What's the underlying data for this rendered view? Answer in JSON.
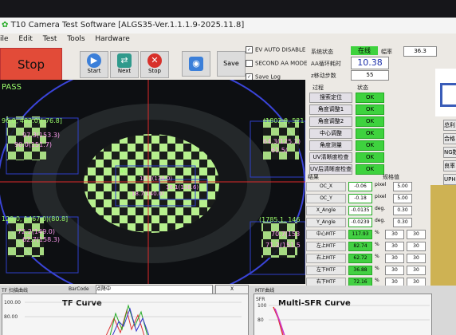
{
  "window": {
    "title": "T10 Camera Test Software [ALGS35-Ver.1.1.1.9-2025.11.8]"
  },
  "menu": [
    "ile",
    "Edit",
    "Test",
    "Tools",
    "Hardware"
  ],
  "toolbar": {
    "stop_big": "Stop",
    "start": "Start",
    "next": "Next",
    "stop": "Stop",
    "save": "Save"
  },
  "checks": [
    {
      "label": "EV AUTO DISABLE",
      "checked": true
    },
    {
      "label": "SECOND AA MODE",
      "checked": false
    },
    {
      "label": "Save Log",
      "checked": true
    }
  ],
  "status": {
    "system_label": "系统状态",
    "system_value": "在线",
    "cycle_label": "幅率",
    "cycle_value": "36.3",
    "aa_label": "AA循环耗时",
    "aa_value": "10.38",
    "z_label": "z移动步数",
    "z_value": "55"
  },
  "camera": {
    "pass_text": "PASS",
    "center_id": "#0",
    "center_coord": "18.7(140.0)",
    "center_val_a": "16.3(138.0)",
    "center_val_b": "16.1(138.6)",
    "tl_coord": "96.0, 482.0)(-76.8]",
    "tl_v1": "97.3(153.3)",
    "tl_v2": "90.0(151.7)",
    "tr_coord": "(1802.0, 521",
    "tr_v1": "64.3(125.2)",
    "tr_v2": "61.5(",
    "bl_coord": "129.0, 1467.0)(80.8]",
    "bl_v1": "72.2(149.0)",
    "bl_v2": "62.7(158.3)",
    "br_coord": "(1785.1, 146",
    "br_v1": "70.7(153",
    "br_v2": "71.2(151.5"
  },
  "process": {
    "header_process": "过程",
    "header_state": "状态",
    "steps": [
      {
        "name": "搜索定位",
        "state": "OK"
      },
      {
        "name": "角度调整1",
        "state": "OK"
      },
      {
        "name": "角度调整2",
        "state": "OK"
      },
      {
        "name": "中心调整",
        "state": "OK"
      },
      {
        "name": "角度测量",
        "state": "OK"
      },
      {
        "name": "UV清晰度检查",
        "state": "OK"
      },
      {
        "name": "UV后清晰度检查",
        "state": "OK"
      }
    ]
  },
  "results": {
    "header_result": "结果",
    "header_spec": "规格值",
    "rows": [
      {
        "name": "OC_X",
        "value": "-0.06",
        "unit": "pixel",
        "spec": "5.00"
      },
      {
        "name": "OC_Y",
        "value": "-0.18",
        "unit": "pixel",
        "spec": "5.00"
      },
      {
        "name": "X_Angle",
        "value": "-0.0135",
        "unit": "deg.",
        "spec": "0.30"
      },
      {
        "name": "Y_Angle",
        "value": "-0.0239",
        "unit": "deg.",
        "spec": "0.30"
      }
    ],
    "mtf": [
      {
        "name": "中心MTF",
        "value": "117.93",
        "unit": "%",
        "spec1": "30",
        "spec2": "30"
      },
      {
        "name": "左上MTF",
        "value": "82.74",
        "unit": "%",
        "spec1": "30",
        "spec2": "30"
      },
      {
        "name": "右上MTF",
        "value": "62.72",
        "unit": "%",
        "spec1": "30",
        "spec2": "30"
      },
      {
        "name": "左下MTF",
        "value": "36.88",
        "unit": "%",
        "spec1": "30",
        "spec2": "30"
      },
      {
        "name": "右下MTF",
        "value": "72.16",
        "unit": "%",
        "spec1": "30",
        "spec2": "30"
      }
    ]
  },
  "right_side": [
    "总利",
    "合格",
    "NG数",
    "良率",
    "UPH"
  ],
  "bottom": {
    "tf_tab": "TF 扫描曲线",
    "barcode_label": "BarCode",
    "barcode_value": "点降中",
    "close_x": "X",
    "mtf_tab": "MTF曲线",
    "tf_title": "TF Curve",
    "tf_ymax": "100.00",
    "tf_ymid": "80.00",
    "sfr_title": "Multi-SFR Curve",
    "sfr_ylabel": "SFR",
    "sfr_ymax": "100",
    "sfr_ymid": "80"
  },
  "colors": {
    "ok_green": "#3ed23e",
    "stop_red": "#e24b38",
    "overlay_green": "#9cff6c",
    "overlay_pink": "#ff9cf0"
  }
}
